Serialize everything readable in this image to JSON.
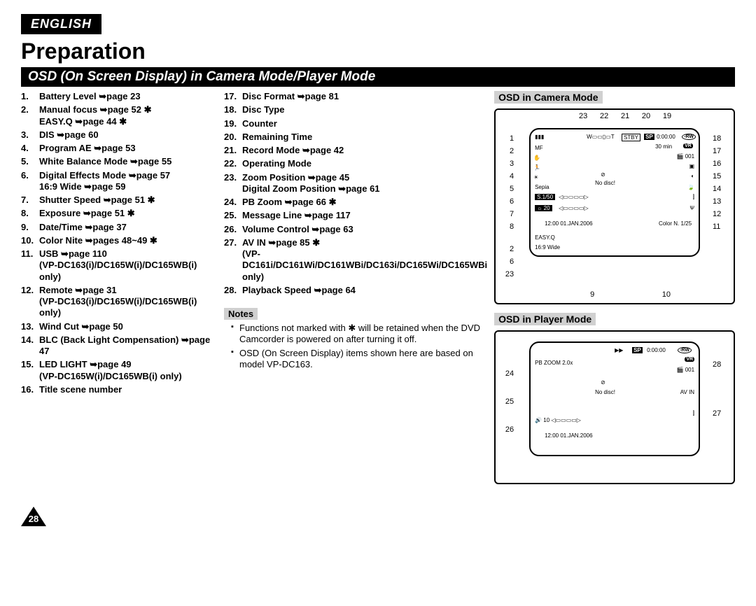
{
  "header": {
    "language": "ENGLISH",
    "title": "Preparation",
    "section": "OSD (On Screen Display) in Camera Mode/Player Mode"
  },
  "list_col1": [
    {
      "n": "1.",
      "text": "Battery Level ➥page 23"
    },
    {
      "n": "2.",
      "text": "Manual focus ➥page 52 ✱",
      "sub": "EASY.Q ➥page 44 ✱"
    },
    {
      "n": "3.",
      "text": "DIS ➥page 60"
    },
    {
      "n": "4.",
      "text": "Program AE ➥page 53"
    },
    {
      "n": "5.",
      "text": "White Balance Mode ➥page 55"
    },
    {
      "n": "6.",
      "text": "Digital Effects Mode ➥page 57",
      "sub": "16:9 Wide ➥page 59"
    },
    {
      "n": "7.",
      "text": "Shutter Speed ➥page 51 ✱"
    },
    {
      "n": "8.",
      "text": "Exposure ➥page 51 ✱"
    },
    {
      "n": "9.",
      "text": "Date/Time ➥page 37"
    },
    {
      "n": "10.",
      "text": "Color Nite ➥pages 48~49 ✱"
    },
    {
      "n": "11.",
      "text": "USB ➥page 110",
      "sub": "(VP-DC163(i)/DC165W(i)/DC165WB(i) only)"
    },
    {
      "n": "12.",
      "text": "Remote ➥page 31",
      "sub": "(VP-DC163(i)/DC165W(i)/DC165WB(i) only)"
    },
    {
      "n": "13.",
      "text": "Wind Cut ➥page 50"
    },
    {
      "n": "14.",
      "text": "BLC (Back Light Compensation) ➥page 47"
    },
    {
      "n": "15.",
      "text": "LED LIGHT ➥page 49",
      "sub": "(VP-DC165W(i)/DC165WB(i) only)"
    },
    {
      "n": "16.",
      "text": "Title scene number"
    }
  ],
  "list_col2": [
    {
      "n": "17.",
      "text": "Disc Format ➥page 81"
    },
    {
      "n": "18.",
      "text": "Disc Type"
    },
    {
      "n": "19.",
      "text": "Counter"
    },
    {
      "n": "20.",
      "text": "Remaining Time"
    },
    {
      "n": "21.",
      "text": "Record Mode ➥page 42"
    },
    {
      "n": "22.",
      "text": "Operating Mode"
    },
    {
      "n": "23.",
      "text": "Zoom Position ➥page 45",
      "sub": "Digital Zoom Position ➥page 61"
    },
    {
      "n": "24.",
      "text": "PB Zoom ➥page 66 ✱"
    },
    {
      "n": "25.",
      "text": "Message Line ➥page 117"
    },
    {
      "n": "26.",
      "text": "Volume Control ➥page 63"
    },
    {
      "n": "27.",
      "text": "AV IN ➥page 85 ✱",
      "sub": "(VP-DC161i/DC161Wi/DC161WBi/DC163i/DC165Wi/DC165WBi only)"
    },
    {
      "n": "28.",
      "text": "Playback Speed ➥page 64"
    }
  ],
  "notes_label": "Notes",
  "notes": [
    "Functions not marked with ✱ will be retained when the DVD Camcorder is powered on after turning it off.",
    "OSD (On Screen Display) items shown here are based on model VP-DC163."
  ],
  "camera_panel_label": "OSD in Camera Mode",
  "player_panel_label": "OSD in Player Mode",
  "camera_callouts": {
    "top": [
      "23",
      "22",
      "21",
      "20",
      "19"
    ],
    "left": [
      "1",
      "2",
      "3",
      "4",
      "5",
      "6",
      "7",
      "8"
    ],
    "right": [
      "18",
      "17",
      "16",
      "15",
      "14",
      "13",
      "12",
      "11"
    ],
    "bottom_left_extra": [
      "2",
      "6",
      "23"
    ],
    "bottom": [
      "9",
      "10"
    ]
  },
  "player_callouts": {
    "left": [
      "24",
      "25",
      "26"
    ],
    "right": [
      "28",
      "27"
    ]
  },
  "camera_screen": {
    "stby": "STBY",
    "sp": "SP",
    "counter": "0:00:00",
    "disc": "-RW",
    "remaining": "30 min",
    "vr": "VR",
    "title": "001",
    "nodisc": "No disc!",
    "sepia": "Sepia",
    "shutter": "S.1/50",
    "exposure": "20",
    "datetime": "12:00 01.JAN.2006",
    "colornite": "Color N. 1/25",
    "easyq": "EASY.Q",
    "wide": "16:9 Wide"
  },
  "player_screen": {
    "pbzoom": "PB ZOOM 2.0x",
    "sp": "SP",
    "counter": "0:00:00",
    "disc": "-RW",
    "vr": "VR",
    "title": "001",
    "nodisc": "No disc!",
    "avin": "AV IN",
    "vol": "10",
    "datetime": "12:00 01.JAN.2006"
  },
  "page_number": "28"
}
